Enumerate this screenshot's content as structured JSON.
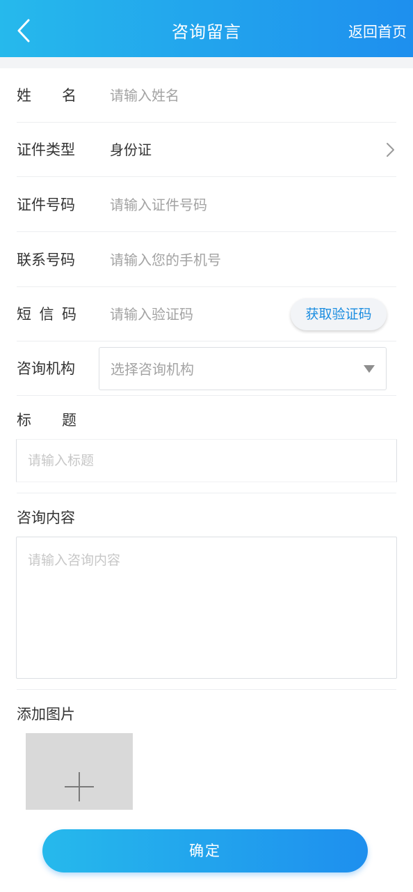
{
  "header": {
    "title": "咨询留言",
    "home_label": "返回首页",
    "back_icon": "chevron-left-icon"
  },
  "form": {
    "name": {
      "label_chars": [
        "姓",
        "名"
      ],
      "placeholder": "请输入姓名"
    },
    "id_type": {
      "label": "证件类型",
      "value": "身份证",
      "icon": "chevron-right-icon"
    },
    "id_number": {
      "label": "证件号码",
      "placeholder": "请输入证件号码"
    },
    "phone": {
      "label": "联系号码",
      "placeholder": "请输入您的手机号"
    },
    "sms": {
      "label_chars": [
        "短",
        "信",
        "码"
      ],
      "placeholder": "请输入验证码",
      "button_label": "获取验证码"
    },
    "org": {
      "label": "咨询机构",
      "placeholder": "选择咨询机构",
      "icon": "caret-down-icon"
    },
    "title": {
      "label_chars": [
        "标",
        "题"
      ],
      "placeholder": "请输入标题"
    },
    "content": {
      "label": "咨询内容",
      "placeholder": "请输入咨询内容"
    },
    "images": {
      "label": "添加图片",
      "icon": "plus-icon"
    }
  },
  "submit_label": "确定",
  "colors": {
    "header_start": "#26b9ec",
    "header_end": "#1e8fee",
    "sms_button_text": "#1b8de0",
    "placeholder": "#a3a3a3"
  }
}
